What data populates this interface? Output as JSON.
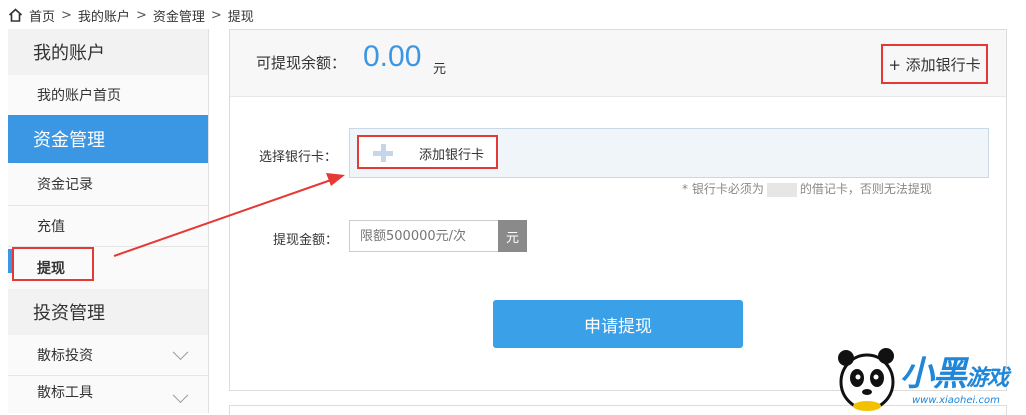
{
  "breadcrumb": {
    "icon": "home-icon",
    "items": [
      "首页",
      "我的账户",
      "资金管理",
      "提现"
    ],
    "separator": ">"
  },
  "sidebar": {
    "sections": [
      {
        "title": "我的账户",
        "items": [
          {
            "label": "我的账户首页"
          }
        ]
      },
      {
        "title": "资金管理",
        "active": true,
        "items": [
          {
            "label": "资金记录"
          },
          {
            "label": "充值"
          },
          {
            "label": "提现",
            "current": true
          }
        ]
      },
      {
        "title": "投资管理",
        "items": [
          {
            "label": "散标投资"
          },
          {
            "label": "散标工具"
          }
        ]
      }
    ]
  },
  "balance": {
    "label": "可提现余额：",
    "value": "0.00",
    "unit": "元",
    "add_card_link": "+ 添加银行卡"
  },
  "form": {
    "card_label": "选择银行卡：",
    "add_card_label": "添加银行卡",
    "card_note_prefix": "* 银行卡必须为",
    "card_note_suffix": "的借记卡，否则无法提现",
    "amount_label": "提现金额：",
    "amount_placeholder": "限额500000元/次",
    "amount_unit": "元",
    "submit_label": "申请提现"
  },
  "colors": {
    "accent": "#3b97e3",
    "highlight": "#e53935",
    "value_blue": "#3b97e3"
  },
  "watermark": {
    "text_big": "小黑",
    "text_small": "游戏",
    "url": "www.xiaohei.com"
  }
}
